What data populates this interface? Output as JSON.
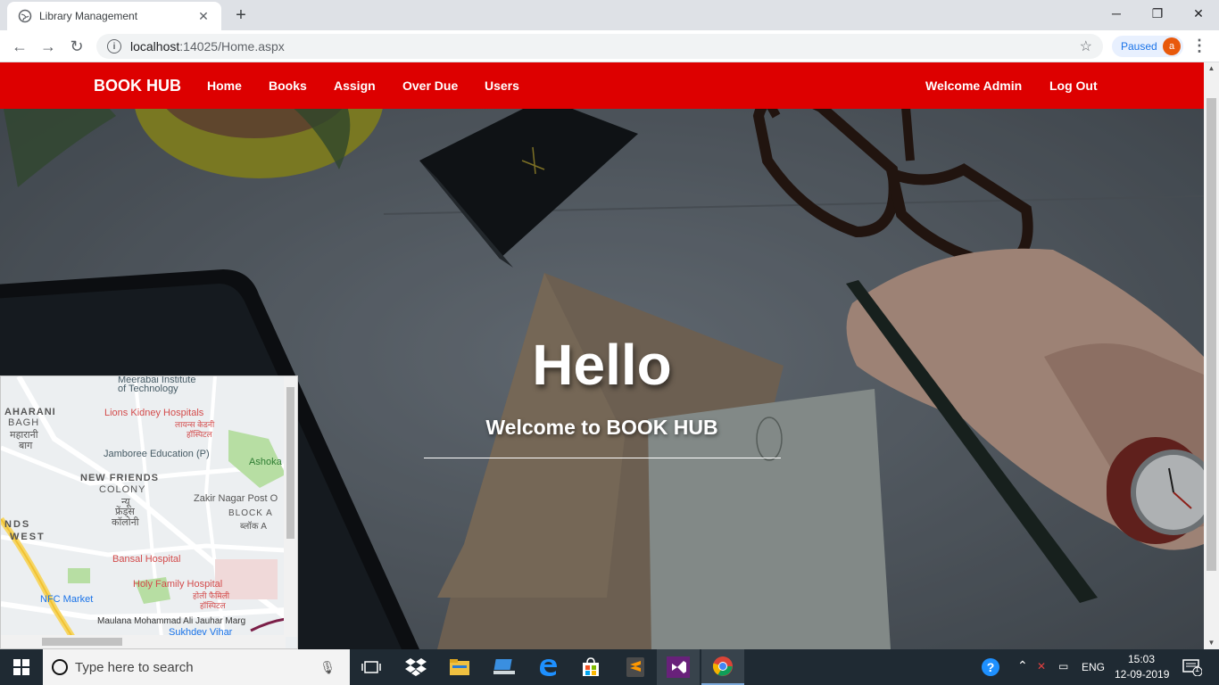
{
  "browser": {
    "tab_title": "Library Management",
    "url_host": "localhost",
    "url_path": ":14025/Home.aspx",
    "paused_label": "Paused",
    "avatar_letter": "a"
  },
  "site": {
    "brand": "BOOK HUB",
    "nav": [
      "Home",
      "Books",
      "Assign",
      "Over Due",
      "Users"
    ],
    "welcome_user": "Welcome Admin",
    "logout": "Log Out",
    "hero_title": "Hello",
    "hero_subtitle": "Welcome to BOOK HUB",
    "accent_color": "#dd0000"
  },
  "map": {
    "labels": [
      "Meerabai Institute",
      "of Technology",
      "AHARANI",
      "BAGH",
      "महारानी",
      "बाग",
      "Lions Kidney Hospitals",
      "लायन्स केडनी",
      "हॉस्पिटल",
      "Jamboree Education (P)",
      "Ashoka",
      "NEW FRIENDS",
      "COLONY",
      "न्यू",
      "फ्रेंड्स",
      "कॉलोनी",
      "Zakir Nagar Post O",
      "BLOCK A",
      "ब्लॉक A",
      "NDS",
      "WEST",
      "Bansal Hospital",
      "Holy Family Hospital",
      "होली फैमिली",
      "हॉस्पिटल",
      "NFC Market",
      "Maulana Mohammad Ali Jauhar Marg",
      "Sukhdev Vihar"
    ]
  },
  "taskbar": {
    "search_placeholder": "Type here to search",
    "language": "ENG",
    "time": "15:03",
    "date": "12-09-2019",
    "notification_count": "1"
  }
}
